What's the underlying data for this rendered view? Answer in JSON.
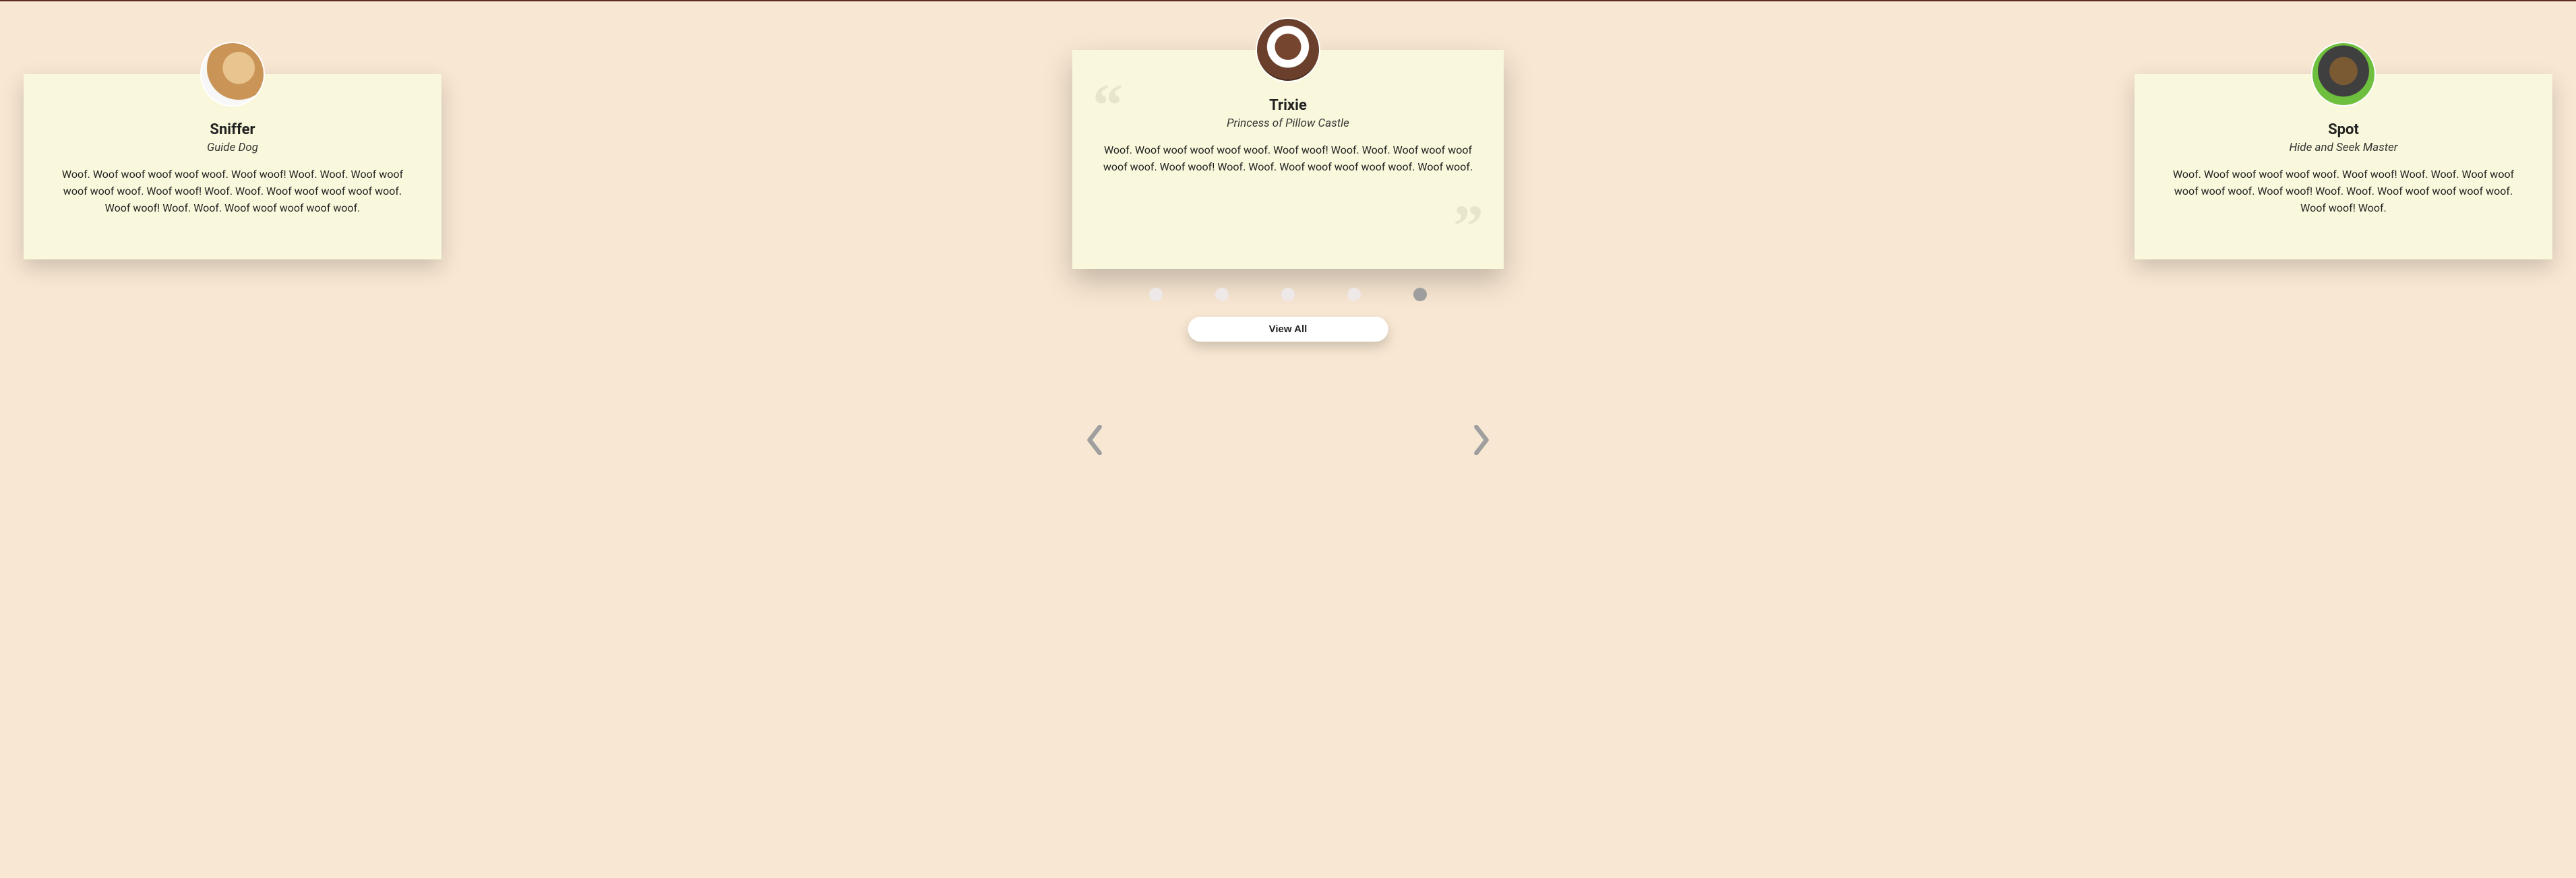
{
  "testimonials": [
    {
      "name": "Sniffer",
      "role": "Guide Dog",
      "body": "Woof. Woof woof woof woof woof. Woof woof! Woof. Woof. Woof woof woof woof woof. Woof woof! Woof. Woof. Woof woof woof woof woof. Woof woof! Woof. Woof. Woof woof woof woof woof."
    },
    {
      "name": "Trixie",
      "role": "Princess of Pillow Castle",
      "body": "Woof. Woof woof woof woof woof. Woof woof! Woof. Woof. Woof woof woof woof woof. Woof woof! Woof. Woof. Woof woof woof woof woof. Woof woof."
    },
    {
      "name": "Spot",
      "role": "Hide and Seek Master",
      "body": "Woof. Woof woof woof woof woof. Woof woof! Woof. Woof. Woof woof woof woof woof. Woof woof! Woof. Woof. Woof woof woof woof woof. Woof woof! Woof."
    }
  ],
  "carousel": {
    "total_dots": 5,
    "active_index": 4
  },
  "buttons": {
    "view_all": "View All"
  }
}
